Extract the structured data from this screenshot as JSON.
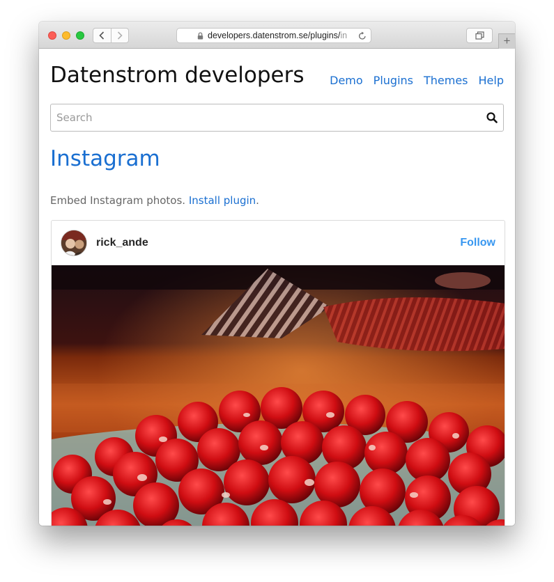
{
  "browser": {
    "url_main": "developers.datenstrom.se/plugins/",
    "url_fade": "in"
  },
  "site": {
    "title": "Datenstrom developers",
    "nav": [
      "Demo",
      "Plugins",
      "Themes",
      "Help"
    ]
  },
  "search": {
    "placeholder": "Search",
    "value": ""
  },
  "page": {
    "heading": "Instagram",
    "description": "Embed Instagram photos.",
    "install_link": "Install plugin",
    "period": "."
  },
  "instagram_embed": {
    "username": "rick_ande",
    "follow_label": "Follow"
  },
  "colors": {
    "link": "#1a6fd1",
    "instagram_follow": "#3897f0",
    "traffic_red": "#fc5f57",
    "traffic_yellow": "#fdbb2d",
    "traffic_green": "#28c840"
  },
  "icons": [
    "back-icon",
    "forward-icon",
    "lock-icon",
    "reload-icon",
    "tabs-overview-icon",
    "new-tab-icon",
    "search-icon"
  ]
}
